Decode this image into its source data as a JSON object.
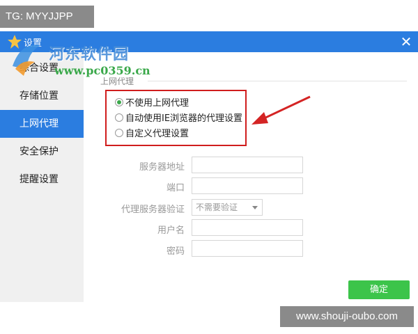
{
  "overlay": {
    "tg_label": "TG: MYYJJPP",
    "bottom_watermark": "www.shouji-oubo.com"
  },
  "watermark": {
    "title": "河东软件园",
    "url": "www.pc0359.cn"
  },
  "window": {
    "title": "设置",
    "close_icon": "close-icon",
    "accent_color": "#2b7de0"
  },
  "sidebar": {
    "items": [
      {
        "label": "综合设置",
        "active": false
      },
      {
        "label": "存储位置",
        "active": false
      },
      {
        "label": "上网代理",
        "active": true
      },
      {
        "label": "安全保护",
        "active": false
      },
      {
        "label": "提醒设置",
        "active": false
      }
    ]
  },
  "proxy": {
    "section_title": "上网代理",
    "options": [
      {
        "label": "不使用上网代理",
        "checked": true
      },
      {
        "label": "自动使用IE浏览器的代理设置",
        "checked": false
      },
      {
        "label": "自定义代理设置",
        "checked": false
      }
    ],
    "fields": {
      "server_label": "服务器地址",
      "server_value": "",
      "port_label": "端口",
      "port_value": "",
      "auth_label": "代理服务器验证",
      "auth_selected": "不需要验证",
      "username_label": "用户名",
      "username_value": "",
      "password_label": "密码",
      "password_value": ""
    }
  },
  "footer": {
    "ok_label": "确定",
    "ok_color": "#3cc44a"
  }
}
